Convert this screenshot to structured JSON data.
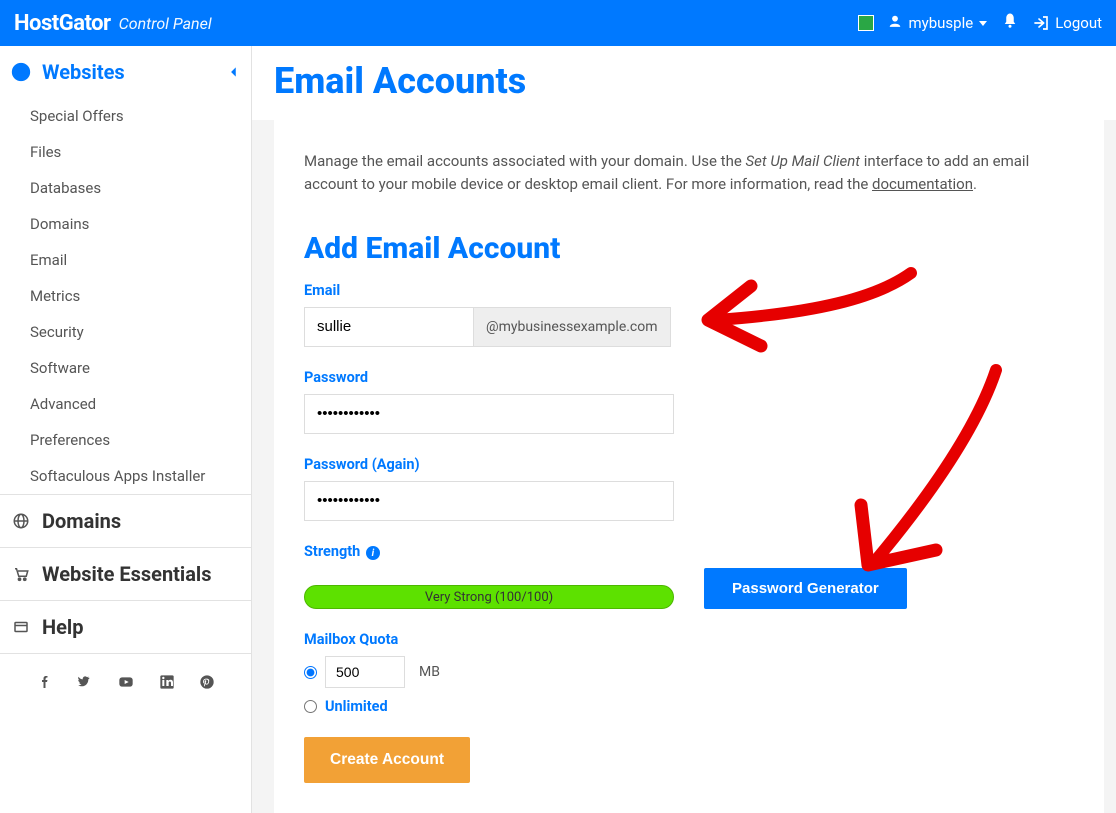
{
  "topbar": {
    "brand": "HostGator",
    "brand_sub": "Control Panel",
    "username": "mybusple",
    "logout": "Logout"
  },
  "sidebar": {
    "categories": [
      {
        "id": "websites",
        "label": "Websites"
      },
      {
        "id": "domains",
        "label": "Domains"
      },
      {
        "id": "essentials",
        "label": "Website Essentials"
      },
      {
        "id": "help",
        "label": "Help"
      }
    ],
    "websites_items": [
      "Special Offers",
      "Files",
      "Databases",
      "Domains",
      "Email",
      "Metrics",
      "Security",
      "Software",
      "Advanced",
      "Preferences",
      "Softaculous Apps Installer"
    ]
  },
  "page": {
    "title": "Email Accounts",
    "description_prefix": "Manage the email accounts associated with your domain. Use the ",
    "description_em": "Set Up Mail Client",
    "description_mid": " interface to add an email account to your mobile device or desktop email client. For more information, read the ",
    "description_link": "documentation",
    "description_suffix": "."
  },
  "form": {
    "section_title": "Add Email Account",
    "labels": {
      "email": "Email",
      "password": "Password",
      "password_again": "Password (Again)",
      "strength": "Strength",
      "quota": "Mailbox Quota",
      "unlimited": "Unlimited"
    },
    "email_value": "sullie",
    "email_domain": "@mybusinessexample.com",
    "password_value": "••••••••••••",
    "password_again_value": "••••••••••••",
    "strength_text": "Very Strong (100/100)",
    "quota_value": "500",
    "quota_unit": "MB",
    "buttons": {
      "password_generator": "Password Generator",
      "create": "Create Account"
    }
  }
}
